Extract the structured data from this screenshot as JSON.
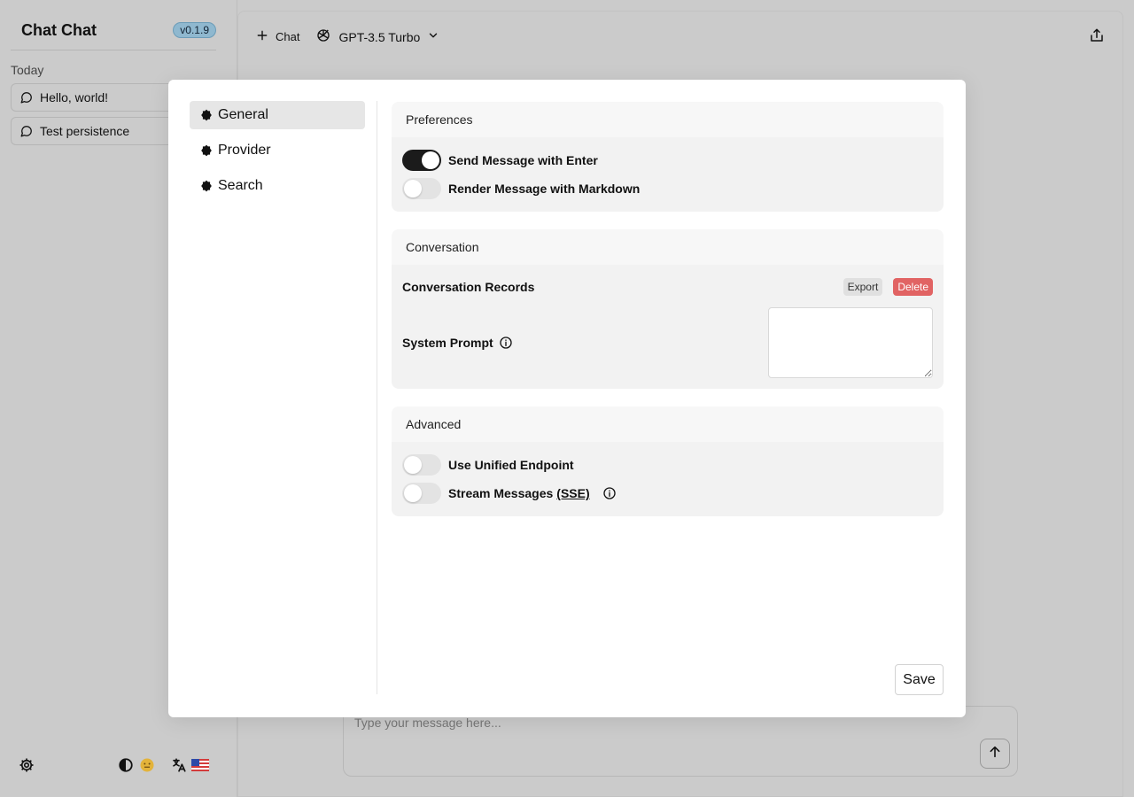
{
  "sidebar": {
    "brand": "Chat Chat",
    "version": "v0.1.9",
    "section_label": "Today",
    "chats": [
      {
        "label": "Hello, world!"
      },
      {
        "label": "Test persistence"
      }
    ],
    "footer_icons": [
      "settings-icon",
      "theme-icon",
      "emoji-icon",
      "translate-icon",
      "flag-icon"
    ]
  },
  "main": {
    "new_chat_label": "Chat",
    "model_label": "GPT-3.5 Turbo",
    "composer_placeholder": "Type your message here..."
  },
  "settings": {
    "nav": [
      {
        "label": "General",
        "active": true
      },
      {
        "label": "Provider",
        "active": false
      },
      {
        "label": "Search",
        "active": false
      }
    ],
    "preferences": {
      "title": "Preferences",
      "send_enter": {
        "label": "Send Message with Enter",
        "on": true
      },
      "render_markdown": {
        "label": "Render Message with Markdown",
        "on": false
      }
    },
    "conversation": {
      "title": "Conversation",
      "records_label": "Conversation Records",
      "export_label": "Export",
      "delete_label": "Delete",
      "system_prompt_label": "System Prompt",
      "system_prompt_value": ""
    },
    "advanced": {
      "title": "Advanced",
      "unified": {
        "label": "Use Unified Endpoint",
        "on": false
      },
      "stream": {
        "label": "Stream Messages",
        "abbr": "(SSE)",
        "on": false
      }
    },
    "save_label": "Save"
  },
  "colors": {
    "overlay_bg": "#cbcbcb",
    "toggle_on": "#1b1b1b",
    "delete": "#e16363",
    "version_badge": "#8fb8cf"
  }
}
